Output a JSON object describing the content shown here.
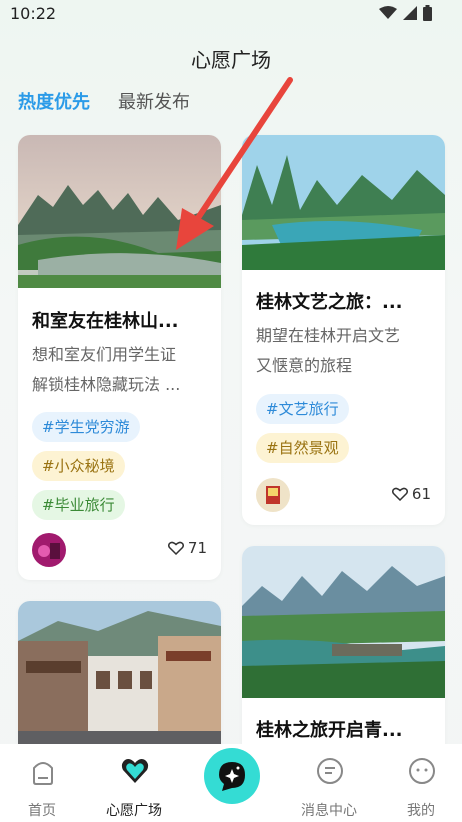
{
  "status": {
    "time": "10:22"
  },
  "header": {
    "title": "心愿广场"
  },
  "tabs": [
    {
      "label": "热度优先",
      "active": true
    },
    {
      "label": "最新发布",
      "active": false
    }
  ],
  "cards": [
    {
      "title": "和室友在桂林山...",
      "desc_lines": [
        "想和室友们用学生证",
        "解锁桂林隐藏玩法 ..."
      ],
      "tags": [
        "#学生党穷游",
        "#小众秘境",
        "#毕业旅行"
      ],
      "likes": "71"
    },
    {
      "title": "桂林文艺之旅：...",
      "desc_lines": [
        "期望在桂林开启文艺",
        "又惬意的旅程"
      ],
      "tags": [
        "#文艺旅行",
        "#自然景观"
      ],
      "likes": "61"
    },
    {
      "title": "桂林之旅开启青..."
    }
  ],
  "nav": {
    "items": [
      {
        "label": "首页"
      },
      {
        "label": "心愿广场"
      },
      {
        "label": "消息中心"
      },
      {
        "label": "我的"
      }
    ]
  },
  "colors": {
    "accent": "#2b9be8",
    "center_button": "#34dcd4",
    "arrow": "#e8453c"
  }
}
